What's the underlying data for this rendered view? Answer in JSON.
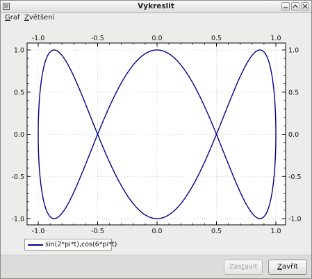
{
  "window": {
    "title": "Vykreslit"
  },
  "menu": [
    {
      "mnemonic": "G",
      "rest": "raf"
    },
    {
      "mnemonic": "Z",
      "rest": "většení"
    }
  ],
  "chart_data": {
    "type": "line",
    "x_ticks": [
      "-1.0",
      "-0.5",
      "0.0",
      "0.5",
      "1.0"
    ],
    "y_ticks": [
      "1.0",
      "0.5",
      "0.0",
      "-0.5",
      "-1.0"
    ],
    "xlim": [
      -1.0,
      1.0
    ],
    "ylim": [
      -1.0,
      1.0
    ],
    "grid": true,
    "legend_position": "bottom-left",
    "series": [
      {
        "name": "sin(2*pi*t),cos(6*pi*t)",
        "color": "#00008b",
        "parametric": {
          "x": "sin(2*pi*t)",
          "y": "cos(6*pi*t)",
          "t_range": [
            0,
            1
          ]
        }
      }
    ]
  },
  "buttons": {
    "stop": {
      "mnemonic": "t",
      "before": "Zas",
      "after": "avit",
      "enabled": false
    },
    "close": {
      "mnemonic": "Z",
      "before": "",
      "after": "avřít",
      "enabled": true
    }
  }
}
